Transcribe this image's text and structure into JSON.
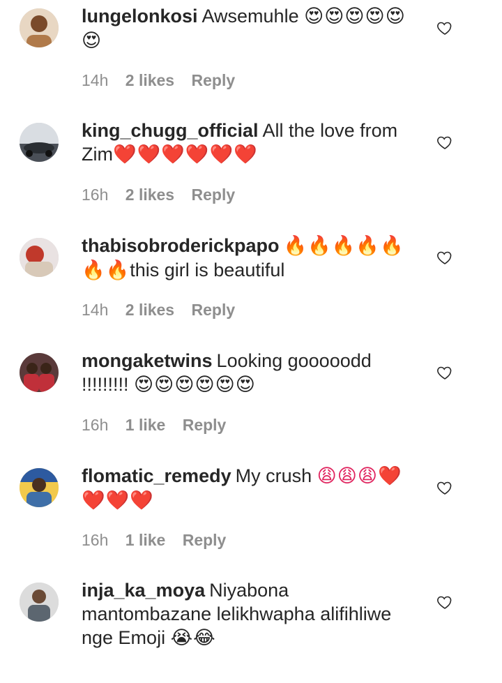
{
  "comments": [
    {
      "username": "lungelonkosi",
      "text": "Awsemuhle",
      "emojis": "😍😍😍😍😍😍",
      "time": "14h",
      "likes": "2 likes",
      "reply": "Reply",
      "avatar_color": "#b07a4a"
    },
    {
      "username": "king_chugg_official",
      "text": "All the love from Zim",
      "emojis": "❤️❤️❤️❤️❤️❤️",
      "time": "16h",
      "likes": "2 likes",
      "reply": "Reply",
      "avatar_color": "#6b7480"
    },
    {
      "username": "thabisobroderickpapo",
      "text": "this girl is beautiful",
      "emojis": "🔥🔥🔥🔥🔥🔥🔥",
      "time": "14h",
      "likes": "2 likes",
      "reply": "Reply",
      "avatar_color": "#c9a0a0"
    },
    {
      "username": "mongaketwins",
      "text": "Looking gooooodd !!!!!!!!!",
      "emojis": "😍😍😍😍😍😍",
      "time": "16h",
      "likes": "1 like",
      "reply": "Reply",
      "avatar_color": "#b8464a"
    },
    {
      "username": "flomatic_remedy",
      "text": "My crush",
      "emojis": "😩😩😩❤️❤️❤️❤️",
      "time": "16h",
      "likes": "1 like",
      "reply": "Reply",
      "avatar_color": "#3f6fa8"
    },
    {
      "username": "inja_ka_moya",
      "text": "Niyabona mantombazane lelikhwapha alifihliwe nge Emoji",
      "emojis": "😭😂",
      "time": "",
      "likes": "",
      "reply": "",
      "avatar_color": "#8a8a8a"
    }
  ],
  "icons": {
    "like": "heart-outline-icon"
  },
  "colors": {
    "text": "#262626",
    "meta": "#8e8e8e",
    "heart_stroke": "#262626"
  }
}
